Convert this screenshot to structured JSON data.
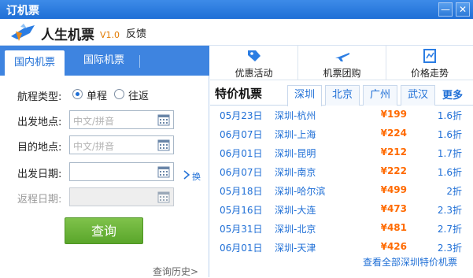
{
  "window": {
    "title": "订机票",
    "minimize": "—",
    "close": "✕"
  },
  "brand": {
    "name": "人生机票",
    "version": "V1.0",
    "feedback": "反馈"
  },
  "tabs": {
    "domestic": "国内机票",
    "international": "国际机票"
  },
  "form": {
    "trip_type_label": "航程类型:",
    "one_way": "单程",
    "round_trip": "往返",
    "from_label": "出发地点:",
    "from_placeholder": "中文/拼音",
    "to_label": "目的地点:",
    "to_placeholder": "中文/拼音",
    "depart_label": "出发日期:",
    "return_label": "返程日期:",
    "swap_label": "换",
    "search_button": "查询",
    "history_link": "查询历史>"
  },
  "toolbar": {
    "promo": "优惠活动",
    "group": "机票团购",
    "trend": "价格走势"
  },
  "specials": {
    "title": "特价机票",
    "cities": [
      "深圳",
      "北京",
      "广州",
      "武汉"
    ],
    "more": "更多",
    "rows": [
      {
        "date": "05月23日",
        "route": "深圳-杭州",
        "price": "¥199",
        "discount": "1.6折"
      },
      {
        "date": "06月07日",
        "route": "深圳-上海",
        "price": "¥224",
        "discount": "1.6折"
      },
      {
        "date": "06月01日",
        "route": "深圳-昆明",
        "price": "¥212",
        "discount": "1.7折"
      },
      {
        "date": "06月07日",
        "route": "深圳-南京",
        "price": "¥222",
        "discount": "1.6折"
      },
      {
        "date": "05月18日",
        "route": "深圳-哈尔滨",
        "price": "¥499",
        "discount": "2折"
      },
      {
        "date": "05月16日",
        "route": "深圳-大连",
        "price": "¥473",
        "discount": "2.3折"
      },
      {
        "date": "05月31日",
        "route": "深圳-北京",
        "price": "¥481",
        "discount": "2.7折"
      },
      {
        "date": "06月01日",
        "route": "深圳-天津",
        "price": "¥426",
        "discount": "2.3折"
      }
    ],
    "view_all": "查看全部深圳特价机票"
  },
  "colors": {
    "accent": "#1f6fd6",
    "price": "#ff6a00",
    "search": "#5aa62b"
  }
}
